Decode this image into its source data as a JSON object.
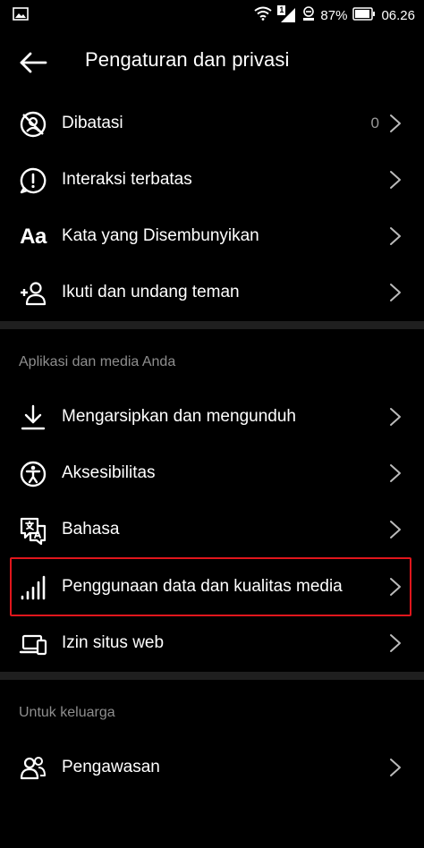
{
  "status_bar": {
    "battery_percent": "87%",
    "time": "06.26",
    "sim_badge": "1"
  },
  "header": {
    "title": "Pengaturan dan privasi"
  },
  "items_top": [
    {
      "label": "Dibatasi",
      "count": "0",
      "icon": "restricted-icon"
    },
    {
      "label": "Interaksi terbatas",
      "icon": "limited-interactions-icon"
    },
    {
      "label": "Kata yang Disembunyikan",
      "icon": "text-aa-icon"
    },
    {
      "label": "Ikuti dan undang teman",
      "icon": "add-person-icon"
    }
  ],
  "section_apps": {
    "title": "Aplikasi dan media Anda",
    "items": [
      {
        "label": "Mengarsipkan dan mengunduh",
        "icon": "download-icon"
      },
      {
        "label": "Aksesibilitas",
        "icon": "accessibility-icon"
      },
      {
        "label": "Bahasa",
        "icon": "translate-icon"
      },
      {
        "label": "Penggunaan data dan kualitas media",
        "icon": "signal-bars-icon"
      },
      {
        "label": "Izin situs web",
        "icon": "devices-icon"
      }
    ]
  },
  "section_family": {
    "title": "Untuk keluarga",
    "items": [
      {
        "label": "Pengawasan",
        "icon": "supervision-icon"
      }
    ]
  },
  "colors": {
    "background": "#000000",
    "divider": "#1f1f1f",
    "highlight": "#e0161c",
    "muted_text": "#8e8e8e"
  }
}
